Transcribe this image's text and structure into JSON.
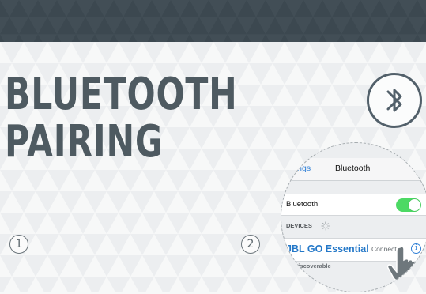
{
  "header": {
    "title_line1": "BLUETOOTH",
    "title_line2": "PAIRING"
  },
  "steps": {
    "step1": "1",
    "step2": "2"
  },
  "bottom_text": "...",
  "icons": {
    "bluetooth": "bluetooth-icon",
    "hand": "hand-pointer-icon",
    "info": "info-icon"
  },
  "phone": {
    "nav_back": "ttings",
    "nav_title": "Bluetooth",
    "bluetooth_label": "Bluetooth",
    "bluetooth_on": true,
    "devices_header": "DEVICES",
    "device_name": "JBL GO Essential",
    "device_status": "Connected",
    "info_symbol": "i",
    "discoverable": "w Discoverable"
  },
  "colors": {
    "top_bar": "#3c4850",
    "title": "#4e5a61",
    "toggle_on": "#4cd964",
    "link_blue": "#2f7fd6",
    "device_blue": "#2478c8"
  }
}
